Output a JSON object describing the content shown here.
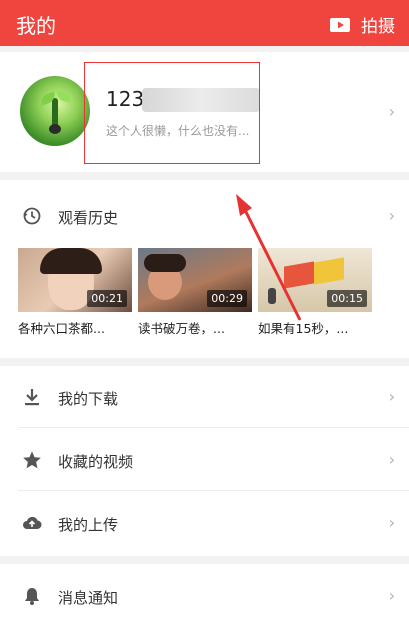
{
  "topbar": {
    "title": "我的",
    "camera_label": "拍摄"
  },
  "profile": {
    "username": "123",
    "signature": "这个人很懒，什么也没有..."
  },
  "history": {
    "title": "观看历史",
    "videos": [
      {
        "duration": "00:21",
        "caption": "各种六口茶都..."
      },
      {
        "duration": "00:29",
        "caption": "读书破万卷，..."
      },
      {
        "duration": "00:15",
        "caption": "如果有15秒，..."
      }
    ]
  },
  "menu": {
    "downloads": "我的下载",
    "favorites": "收藏的视频",
    "uploads": "我的上传",
    "notifications": "消息通知"
  },
  "colors": {
    "accent": "#f0453f",
    "annotation": "#e33333"
  }
}
